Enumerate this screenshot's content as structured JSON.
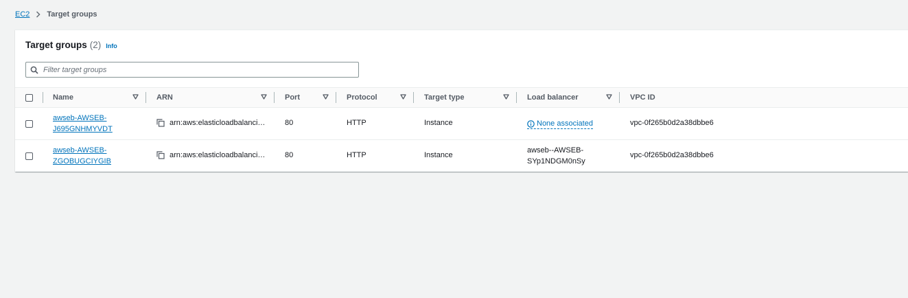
{
  "breadcrumb": {
    "root": "EC2",
    "current": "Target groups"
  },
  "panel": {
    "title": "Target groups",
    "count": "(2)",
    "info": "Info"
  },
  "filter": {
    "placeholder": "Filter target groups",
    "value": ""
  },
  "columns": [
    "Name",
    "ARN",
    "Port",
    "Protocol",
    "Target type",
    "Load balancer",
    "VPC ID"
  ],
  "rows": [
    {
      "name_line1": "awseb-AWSEB-",
      "name_line2": "J695GNHMYVDT",
      "arn": "arn:aws:elasticloadbalanci…",
      "port": "80",
      "protocol": "HTTP",
      "target_type": "Instance",
      "load_balancer": "None associated",
      "vpc_id": "vpc-0f265b0d2a38dbbe6"
    },
    {
      "name_line1": "awseb-AWSEB-",
      "name_line2": "ZGOBUGCIYGIB",
      "arn": "arn:aws:elasticloadbalanci…",
      "port": "80",
      "protocol": "HTTP",
      "target_type": "Instance",
      "load_balancer_line1": "awseb--AWSEB-",
      "load_balancer_line2": "SYp1NDGM0nSy",
      "vpc_id": "vpc-0f265b0d2a38dbbe6"
    }
  ],
  "icons": {
    "breadcrumb_separator": "chevron-right-icon",
    "search": "search-icon",
    "sort": "sort-down-icon",
    "copy": "copy-icon",
    "info": "info-icon"
  },
  "colors": {
    "link": "#0073bb",
    "background": "#f2f3f3",
    "panel": "#ffffff"
  }
}
